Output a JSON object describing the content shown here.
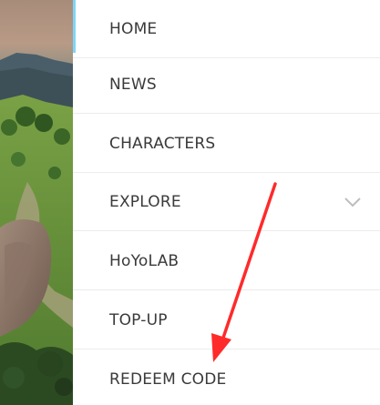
{
  "menu": {
    "items": [
      {
        "label": "HOME",
        "active": true
      },
      {
        "label": "NEWS"
      },
      {
        "label": "CHARACTERS"
      },
      {
        "label": "EXPLORE",
        "icon": "chevron-down-icon"
      },
      {
        "label": "HoYoLAB"
      },
      {
        "label": "TOP-UP"
      },
      {
        "label": "REDEEM CODE"
      }
    ]
  },
  "colors": {
    "active_indicator": "#7ed6f5",
    "annotation_arrow": "#ff2a2a",
    "label_text": "#3a3a3a",
    "divider": "#ececec"
  }
}
